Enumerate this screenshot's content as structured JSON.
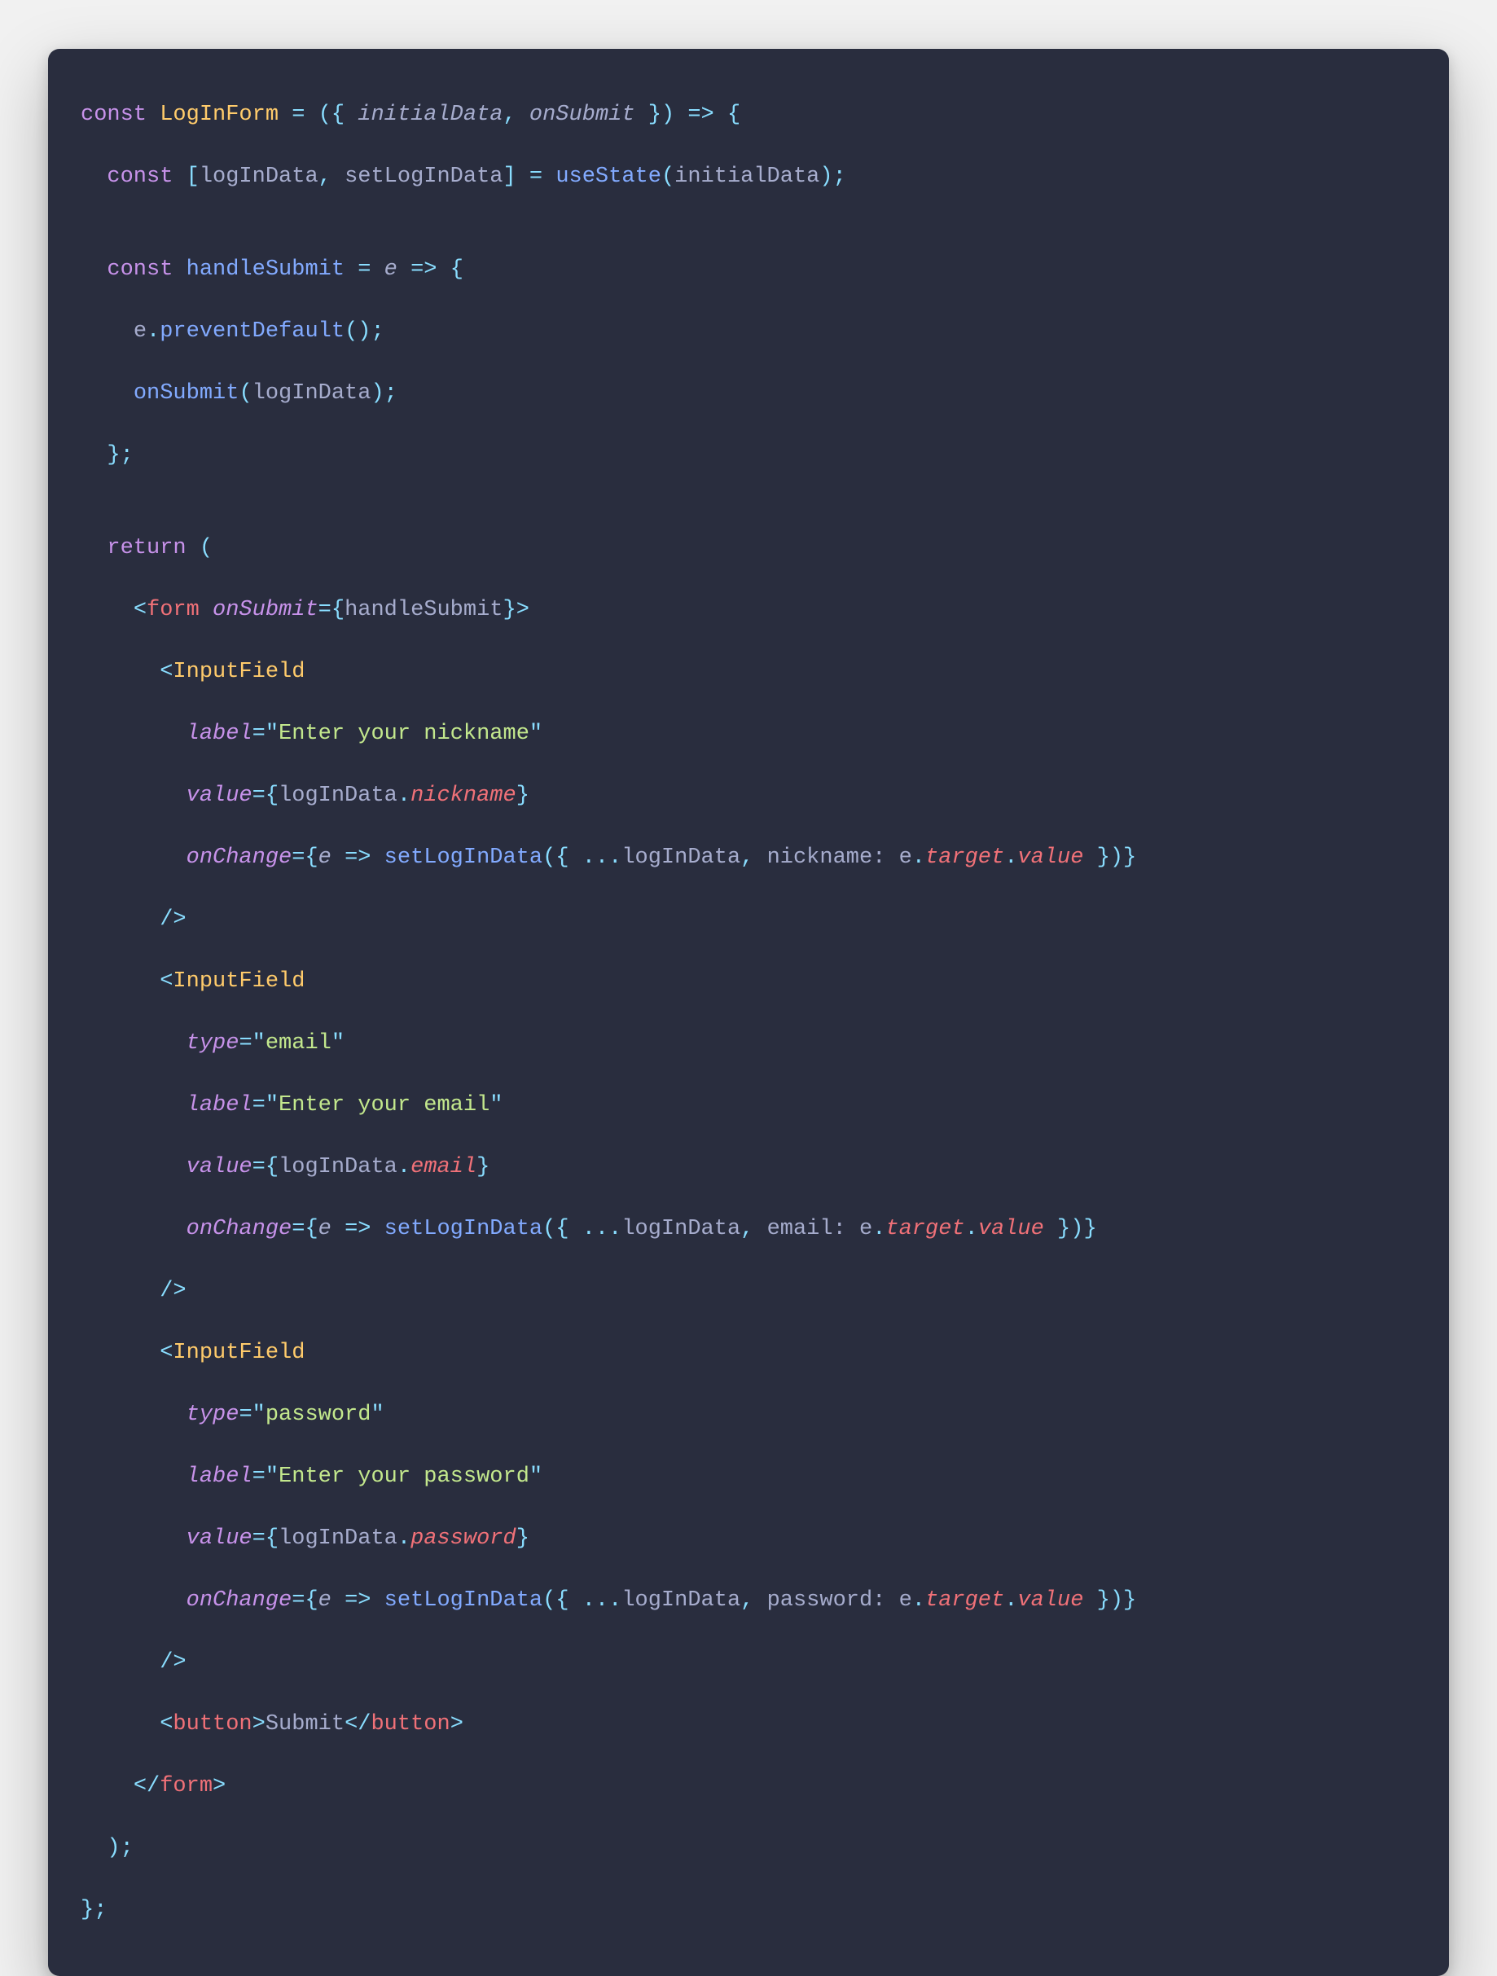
{
  "code": {
    "componentName": "LogInForm",
    "paramDestructure": {
      "initialData": "initialData",
      "onSubmit": "onSubmit"
    },
    "stateDecl": {
      "var": "logInData",
      "setter": "setLogInData",
      "hook": "useState",
      "arg": "initialData"
    },
    "handleSubmit": {
      "name": "handleSubmit",
      "param": "e",
      "body": [
        "e.preventDefault();",
        "onSubmit(logInData);"
      ]
    },
    "jsx": {
      "form": {
        "onSubmitHandler": "handleSubmit"
      },
      "inputFieldTag": "InputField",
      "fields": [
        {
          "label": "Enter your nickname",
          "valueExpr": "logInData.nickname",
          "changeProp": "nickname"
        },
        {
          "type": "email",
          "label": "Enter your email",
          "valueExpr": "logInData.email",
          "changeProp": "email"
        },
        {
          "type": "password",
          "label": "Enter your password",
          "valueExpr": "logInData.password",
          "changeProp": "password"
        }
      ],
      "button": {
        "label": "Submit"
      }
    },
    "idents": {
      "const": "const",
      "return": "return",
      "e": "e",
      "preventDefault": "preventDefault",
      "target": "target",
      "value": "value",
      "setLogInData": "setLogInData",
      "logInData": "logInData",
      "spread": "...logInData",
      "formTag": "form",
      "buttonTag": "button",
      "labelAttr": "label",
      "valueAttr": "value",
      "typeAttr": "type",
      "onChangeAttr": "onChange",
      "onSubmitAttr": "onSubmit",
      "nicknameProp": "nickname",
      "emailProp": "email",
      "passwordProp": "password",
      "nicknameKey": "nickname:",
      "emailKey": "email:",
      "passwordKey": "password:"
    }
  }
}
